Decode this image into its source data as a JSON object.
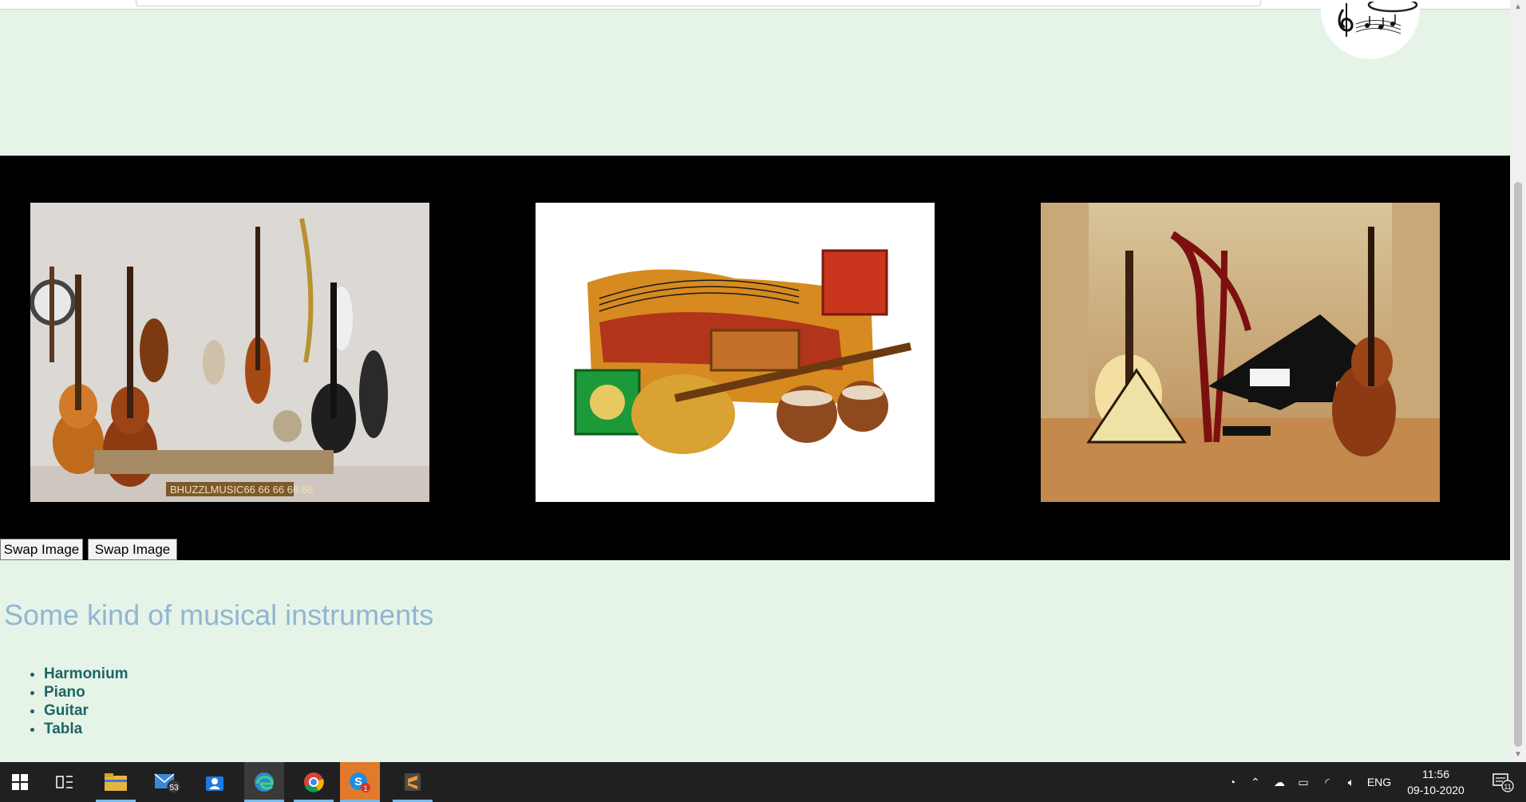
{
  "gallery": {
    "swap_button_1": "Swap Image",
    "swap_button_2": "Swap Image",
    "image1_caption": "BHUZZLMUSIC66 66 66 66 66"
  },
  "content": {
    "heading": "Some kind of musical instruments",
    "instruments": [
      "Harmonium",
      "Piano",
      "Guitar",
      "Tabla"
    ]
  },
  "taskbar": {
    "mail_badge": "53",
    "skype_badge": "1",
    "language": "ENG",
    "time": "11:56",
    "date": "09-10-2020",
    "notification_count": "11"
  },
  "icons": {
    "start": "windows-start-icon",
    "task_view": "task-view-icon",
    "file_explorer": "folder-icon",
    "mail": "mail-icon",
    "store": "store-icon",
    "edge": "edge-icon",
    "chrome": "chrome-icon",
    "skype": "skype-icon",
    "sublime": "sublime-icon"
  },
  "colors": {
    "page_bg": "#e6f4e8",
    "gallery_bg": "#000000",
    "heading": "#8fb6d4",
    "list_text": "#1d6565",
    "taskbar": "#202020"
  }
}
